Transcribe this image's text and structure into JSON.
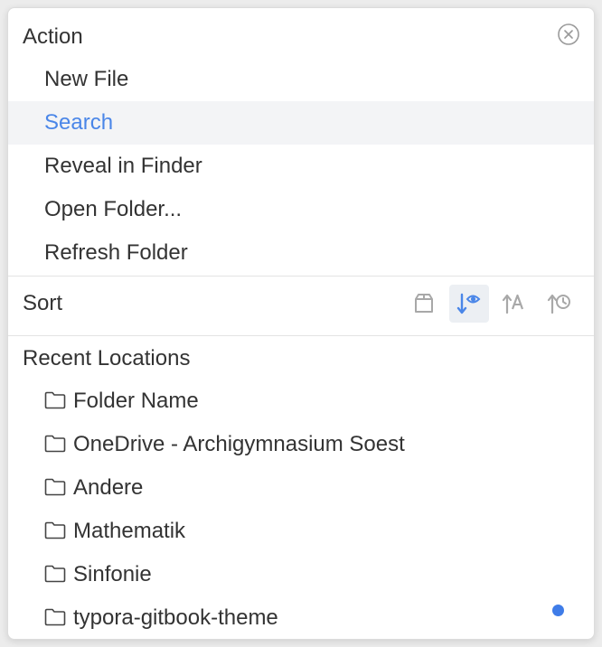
{
  "action": {
    "title": "Action",
    "items": [
      {
        "label": "New File",
        "active": false
      },
      {
        "label": "Search",
        "active": true
      },
      {
        "label": "Reveal in Finder",
        "active": false
      },
      {
        "label": "Open Folder...",
        "active": false
      },
      {
        "label": "Refresh Folder",
        "active": false
      }
    ]
  },
  "sort": {
    "label": "Sort",
    "icons": [
      {
        "name": "sort-natural-icon",
        "selected": false
      },
      {
        "name": "sort-by-views-icon",
        "selected": true
      },
      {
        "name": "sort-alphabetical-icon",
        "selected": false
      },
      {
        "name": "sort-by-time-icon",
        "selected": false
      }
    ]
  },
  "recent": {
    "title": "Recent Locations",
    "items": [
      {
        "label": "Folder Name"
      },
      {
        "label": "OneDrive - Archigymnasium Soest"
      },
      {
        "label": "Andere"
      },
      {
        "label": "Mathematik"
      },
      {
        "label": "Sinfonie"
      },
      {
        "label": "typora-gitbook-theme",
        "indicator": true
      }
    ]
  },
  "colors": {
    "accent": "#4a86e8",
    "active_bg": "#f3f4f6",
    "dot": "#3f7ce8"
  }
}
